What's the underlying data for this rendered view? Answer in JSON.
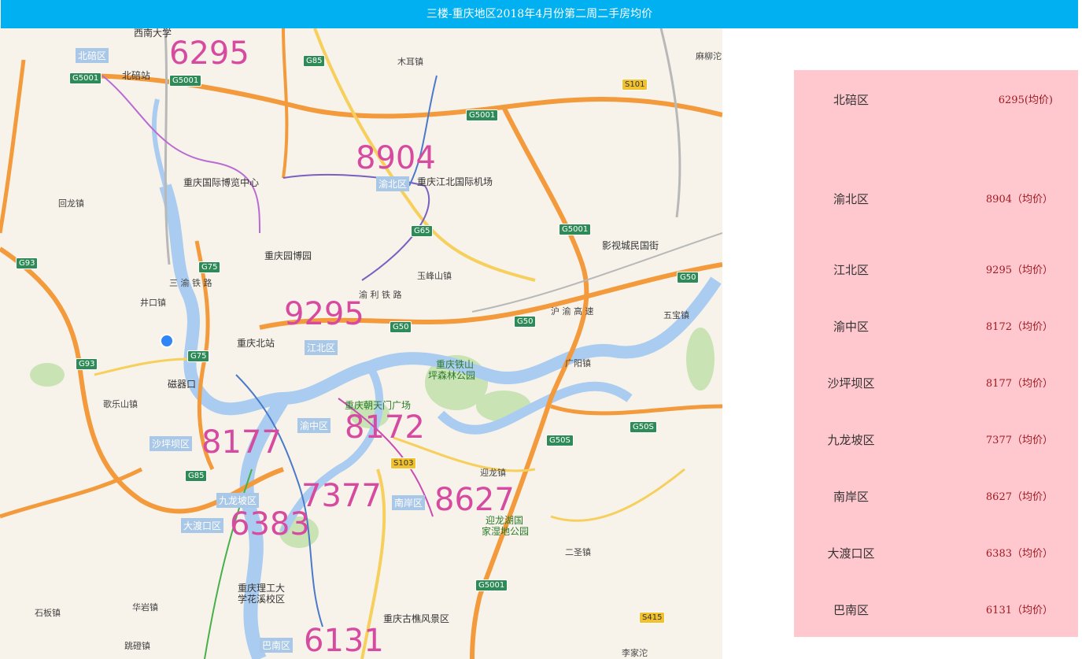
{
  "header": {
    "title": "三楼-重庆地区2018年4月份第二周二手房均价"
  },
  "map": {
    "prices": [
      "6295",
      "8904",
      "9295",
      "8177",
      "8172",
      "7377",
      "8627",
      "6383",
      "6131"
    ],
    "districts": [
      "北碚区",
      "渝北区",
      "江北区",
      "沙坪坝区",
      "渝中区",
      "九龙坡区",
      "南岸区",
      "大渡口区",
      "巴南区"
    ],
    "places": [
      "西南大学",
      "北碚站",
      "木耳镇",
      "麻柳沱",
      "重庆国际博览中心",
      "重庆江北国际机场",
      "回龙镇",
      "重庆园博园",
      "影视城民国街",
      "玉峰山镇",
      "井口镇",
      "五宝镇",
      "重庆北站",
      "重庆铁山",
      "坪森林公园",
      "广阳镇",
      "磁器口",
      "歌乐山镇",
      "重庆朝天门广场",
      "迎龙镇",
      "迎龙湖国",
      "家湿地公园",
      "二圣镇",
      "重庆理工大",
      "学花溪校区",
      "华岩镇",
      "石板镇",
      "重庆古樵风景区",
      "跳磴镇",
      "李家沱"
    ],
    "roads": [
      "G5001",
      "G85",
      "G93",
      "G75",
      "G65",
      "G50",
      "G50S",
      "S101",
      "S103",
      "S415",
      "渝 利 铁 路",
      "沪 渝 高 速",
      "三 渝 铁 路"
    ]
  },
  "sidebar": {
    "rows": [
      {
        "name": "北碚区",
        "value": "6295(均价)"
      },
      {
        "name": "渝北区",
        "value": "8904（均价）"
      },
      {
        "name": "江北区",
        "value": "9295（均价）"
      },
      {
        "name": "渝中区",
        "value": "8172（均价）"
      },
      {
        "name": "沙坪坝区",
        "value": "8177（均价）"
      },
      {
        "name": "九龙坡区",
        "value": "7377（均价）"
      },
      {
        "name": "南岸区",
        "value": "8627（均价）"
      },
      {
        "name": "大渡口区",
        "value": "6383（均价）"
      },
      {
        "name": "巴南区",
        "value": "6131（均价）"
      }
    ]
  },
  "colors": {
    "header": "#00b0f0",
    "sidebar": "#ffc7ce",
    "price": "#d64aa0",
    "value": "#a01820"
  }
}
